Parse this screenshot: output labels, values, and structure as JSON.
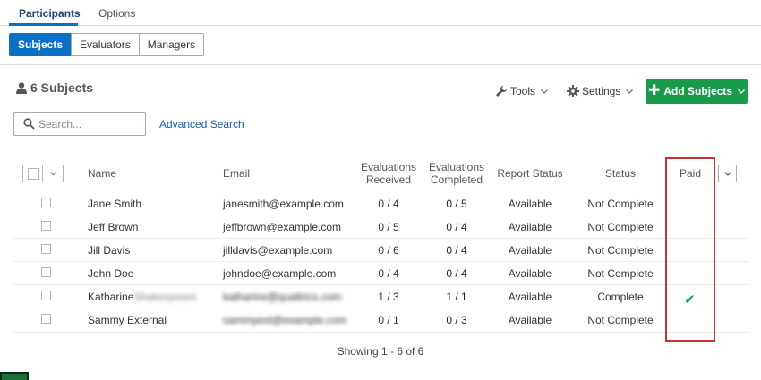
{
  "tabs": {
    "participants": "Participants",
    "options": "Options"
  },
  "segments": {
    "subjects": "Subjects",
    "evaluators": "Evaluators",
    "managers": "Managers"
  },
  "summary": {
    "count": "6 Subjects"
  },
  "toolbar": {
    "tools": "Tools",
    "settings": "Settings",
    "add": "Add Subjects"
  },
  "search": {
    "placeholder": "Search...",
    "advanced": "Advanced Search"
  },
  "columns": {
    "name": "Name",
    "email": "Email",
    "eval_received_1": "Evaluations",
    "eval_received_2": "Received",
    "eval_completed_1": "Evaluations",
    "eval_completed_2": "Completed",
    "report_status": "Report Status",
    "status": "Status",
    "paid": "Paid"
  },
  "rows": [
    {
      "name": "Jane Smith",
      "email": "janesmith@example.com",
      "received": "0 / 4",
      "completed": "0 / 5",
      "report": "Available",
      "status": "Not Complete",
      "paid": ""
    },
    {
      "name": "Jeff Brown",
      "email": "jeffbrown@example.com",
      "received": "0 / 5",
      "completed": "0 / 4",
      "report": "Available",
      "status": "Not Complete",
      "paid": ""
    },
    {
      "name": "Jill Davis",
      "email": "jilldavis@example.com",
      "received": "0 / 6",
      "completed": "0 / 4",
      "report": "Available",
      "status": "Not Complete",
      "paid": ""
    },
    {
      "name": "John Doe",
      "email": "johndoe@example.com",
      "received": "0 / 4",
      "completed": "0 / 4",
      "report": "Available",
      "status": "Not Complete",
      "paid": ""
    },
    {
      "name": "Katharine",
      "name_hidden": "Shakespeare",
      "email": "katharine@qualtrics.com",
      "received": "1 / 3",
      "completed": "1 / 1",
      "report": "Available",
      "status": "Complete",
      "paid": "✔"
    },
    {
      "name": "Sammy External",
      "email": "sammyext@example.com",
      "received": "0 / 1",
      "completed": "0 / 3",
      "report": "Available",
      "status": "Not Complete",
      "paid": ""
    }
  ],
  "footer": {
    "showing": "Showing 1 - 6 of 6"
  }
}
